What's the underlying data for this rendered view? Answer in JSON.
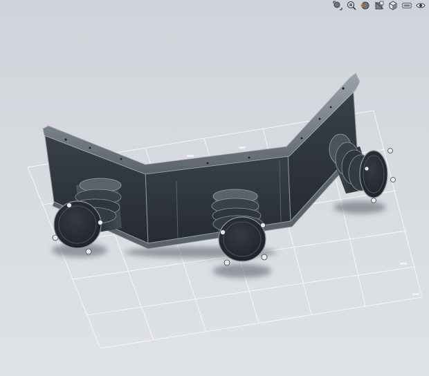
{
  "viewport": {
    "type": "3d-model-view",
    "background": "#d7dbe0",
    "model_color": "#2f353c",
    "edge_color": "#8e969e",
    "grid_color": "#f4f6f8"
  },
  "toolbar": {
    "buttons": [
      {
        "name": "zoom-to-fit-icon"
      },
      {
        "name": "zoom-to-area-icon"
      },
      {
        "name": "previous-view-icon"
      },
      {
        "name": "section-view-icon"
      },
      {
        "name": "view-orientation-icon"
      },
      {
        "name": "display-style-icon"
      },
      {
        "name": "hide-show-items-icon"
      }
    ]
  }
}
